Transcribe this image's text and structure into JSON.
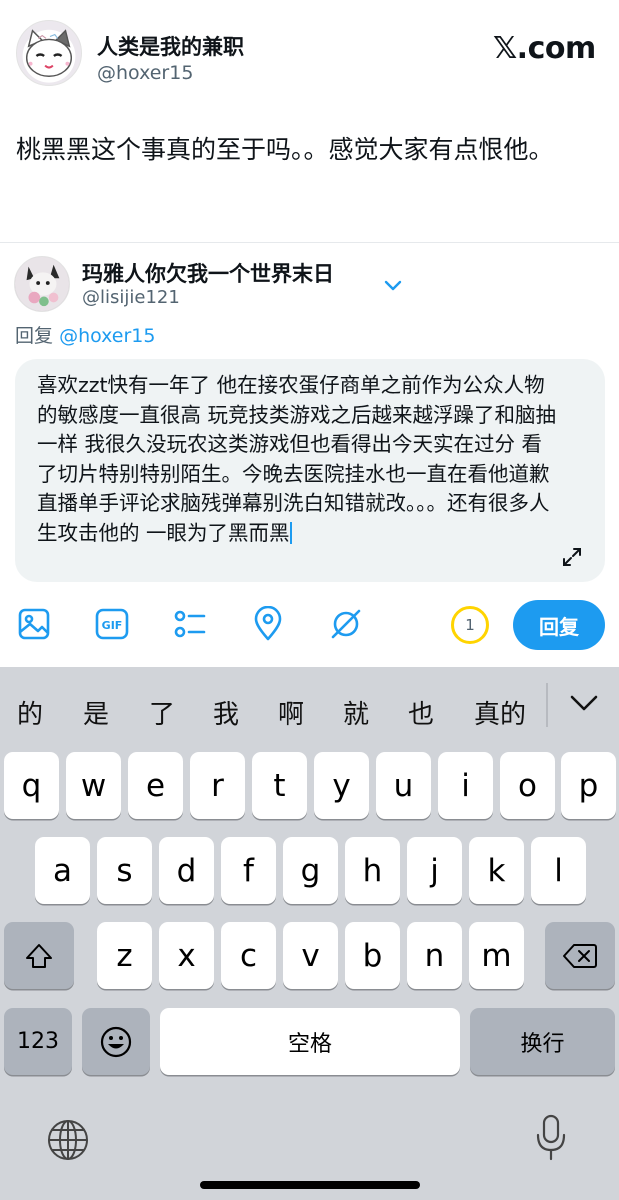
{
  "original_post": {
    "display_name": "人类是我的兼职",
    "handle": "@hoxer15",
    "brand": "𝕏.com",
    "text": "桃黑黑这个事真的至于吗。。感觉大家有点恨他。"
  },
  "reply": {
    "display_name": "玛雅人你欠我一个世界末日",
    "handle": "@lisijie121",
    "replying_prefix": "回复",
    "replying_to": "@hoxer15",
    "draft_text": "喜欢zzt快有一年了 他在接农蛋仔商单之前作为公众人物的敏感度一直很高 玩竞技类游戏之后越来越浮躁了和脑抽一样 我很久没玩农这类游戏但也看得出今天实在过分 看了切片特别特别陌生。今晚去医院挂水也一直在看他道歉直播单手评论求脑残弹幕别洗白知错就改。。。还有很多人生攻击他的 一眼为了黑而黑"
  },
  "toolbar": {
    "icons": [
      "image-icon",
      "gif-icon",
      "poll-icon",
      "location-icon",
      "circle-slash-icon"
    ],
    "gif_label": "GIF",
    "counter": "1",
    "reply_button": "回复"
  },
  "keyboard": {
    "candidates": [
      "的",
      "是",
      "了",
      "我",
      "啊",
      "就",
      "也",
      "真的"
    ],
    "row1": [
      "q",
      "w",
      "e",
      "r",
      "t",
      "y",
      "u",
      "i",
      "o",
      "p"
    ],
    "row2": [
      "a",
      "s",
      "d",
      "f",
      "g",
      "h",
      "j",
      "k",
      "l"
    ],
    "row3": [
      "z",
      "x",
      "c",
      "v",
      "b",
      "n",
      "m"
    ],
    "numbers_key": "123",
    "space_key": "空格",
    "return_key": "换行"
  },
  "colors": {
    "accent": "#1d9bf0",
    "counter_ring": "#ffd400",
    "composer_bg": "#eff3f4",
    "keyboard_bg": "#d1d4d9"
  }
}
